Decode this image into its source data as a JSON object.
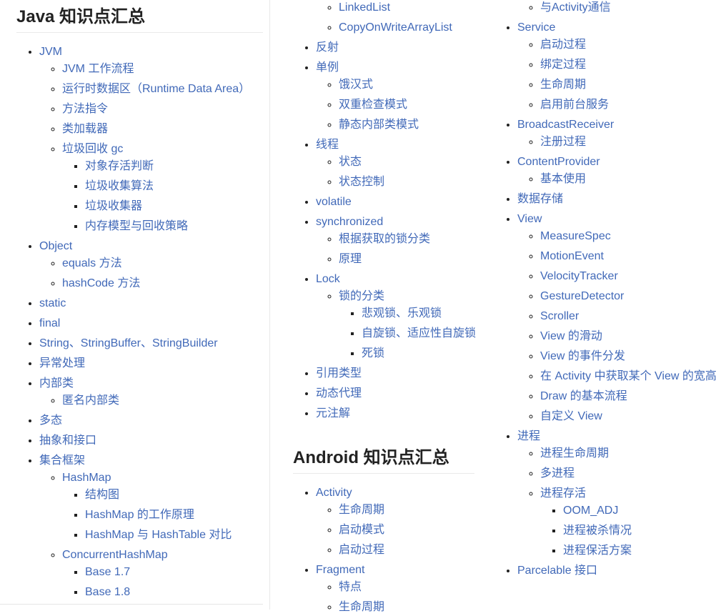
{
  "colors": {
    "link": "#4169b8",
    "text": "#333333",
    "heading": "#222222"
  },
  "java": {
    "title": "Java 知识点汇总",
    "items": [
      {
        "label": "JVM",
        "children": [
          {
            "label": "JVM 工作流程"
          },
          {
            "label": "运行时数据区（Runtime Data Area）"
          },
          {
            "label": "方法指令"
          },
          {
            "label": "类加载器"
          },
          {
            "label": "垃圾回收 gc",
            "children": [
              {
                "label": "对象存活判断"
              },
              {
                "label": "垃圾收集算法"
              },
              {
                "label": "垃圾收集器"
              },
              {
                "label": "内存模型与回收策略"
              }
            ]
          }
        ]
      },
      {
        "label": "Object",
        "children": [
          {
            "label": "equals 方法"
          },
          {
            "label": "hashCode 方法"
          }
        ]
      },
      {
        "label": "static"
      },
      {
        "label": "final"
      },
      {
        "label": "String、StringBuffer、StringBuilder"
      },
      {
        "label": "异常处理"
      },
      {
        "label": "内部类",
        "children": [
          {
            "label": "匿名内部类"
          }
        ]
      },
      {
        "label": "多态"
      },
      {
        "label": "抽象和接口"
      },
      {
        "label": "集合框架",
        "children": [
          {
            "label": "HashMap",
            "children": [
              {
                "label": "结构图"
              },
              {
                "label": "HashMap 的工作原理"
              },
              {
                "label": "HashMap 与 HashTable 对比"
              }
            ]
          },
          {
            "label": "ConcurrentHashMap",
            "children": [
              {
                "label": "Base 1.7"
              },
              {
                "label": "Base 1.8"
              }
            ]
          }
        ]
      }
    ]
  },
  "java_cont": {
    "items": [
      {
        "hidden": true,
        "children": [
          {
            "label": "LinkedList"
          },
          {
            "label": "CopyOnWriteArrayList"
          }
        ]
      },
      {
        "label": "反射"
      },
      {
        "label": "单例",
        "children": [
          {
            "label": "饿汉式"
          },
          {
            "label": "双重检查模式"
          },
          {
            "label": "静态内部类模式"
          }
        ]
      },
      {
        "label": "线程",
        "children": [
          {
            "label": "状态"
          },
          {
            "label": "状态控制"
          }
        ]
      },
      {
        "label": "volatile"
      },
      {
        "label": "synchronized",
        "children": [
          {
            "label": "根据获取的锁分类"
          },
          {
            "label": "原理"
          }
        ]
      },
      {
        "label": "Lock",
        "children": [
          {
            "label": "锁的分类",
            "children": [
              {
                "label": "悲观锁、乐观锁"
              },
              {
                "label": "自旋锁、适应性自旋锁"
              },
              {
                "label": "死锁"
              }
            ]
          }
        ]
      },
      {
        "label": "引用类型"
      },
      {
        "label": "动态代理"
      },
      {
        "label": "元注解"
      }
    ]
  },
  "android": {
    "title": "Android 知识点汇总",
    "items": [
      {
        "label": "Activity",
        "children": [
          {
            "label": "生命周期"
          },
          {
            "label": "启动模式"
          },
          {
            "label": "启动过程"
          }
        ]
      },
      {
        "label": "Fragment",
        "children": [
          {
            "label": "特点"
          },
          {
            "label": "生命周期"
          }
        ]
      }
    ]
  },
  "android_cont": {
    "items": [
      {
        "hidden": true,
        "children": [
          {
            "label": "与Activity通信"
          }
        ]
      },
      {
        "label": "Service",
        "children": [
          {
            "label": "启动过程"
          },
          {
            "label": "绑定过程"
          },
          {
            "label": "生命周期"
          },
          {
            "label": "启用前台服务"
          }
        ]
      },
      {
        "label": "BroadcastReceiver",
        "children": [
          {
            "label": "注册过程"
          }
        ]
      },
      {
        "label": "ContentProvider",
        "children": [
          {
            "label": "基本使用"
          }
        ]
      },
      {
        "label": "数据存储"
      },
      {
        "label": "View",
        "children": [
          {
            "label": "MeasureSpec"
          },
          {
            "label": "MotionEvent"
          },
          {
            "label": "VelocityTracker"
          },
          {
            "label": "GestureDetector"
          },
          {
            "label": "Scroller"
          },
          {
            "label": "View 的滑动"
          },
          {
            "label": "View 的事件分发"
          },
          {
            "label": "在 Activity 中获取某个 View 的宽高"
          },
          {
            "label": "Draw 的基本流程"
          },
          {
            "label": "自定义 View"
          }
        ]
      },
      {
        "label": "进程",
        "children": [
          {
            "label": "进程生命周期"
          },
          {
            "label": "多进程"
          },
          {
            "label": "进程存活",
            "children": [
              {
                "label": "OOM_ADJ"
              },
              {
                "label": "进程被杀情况"
              },
              {
                "label": "进程保活方案"
              }
            ]
          }
        ]
      },
      {
        "label": "Parcelable 接口"
      }
    ]
  }
}
